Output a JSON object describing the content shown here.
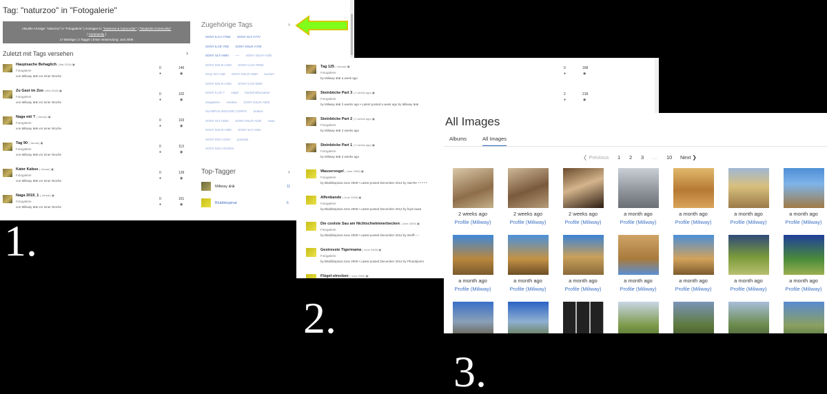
{
  "panel1": {
    "title": "Tag: \"naturzoo\" in \"Fotogalerie\"",
    "banner": {
      "line1": "Aktuelle Anzeige: \"naturzoo\" in \"Fotogalerie\" [ Anzeigen in:",
      "link1": "\"Kameras & Camcorder\"",
      "sep": "|",
      "link2": "\"Deutsche Community\"",
      "link3": "Community",
      "close": "]",
      "stats": "17 Beiträge   |   2 Tagger   |   Erste Verwendung:   Juni 2009"
    },
    "recent_heading": "Zuletzt mit Tags versehen",
    "chevron": "›",
    "rows": [
      {
        "name": "Hauptsache Behaglich",
        "date": "( Mai 2019)",
        "cat": "Fotogalerie",
        "by": "von Miliway ⊕⊕ vor einer Woche",
        "n1": "0",
        "n2": "146"
      },
      {
        "name": "Zu Gast im Zoo",
        "date": "( Mai 2018)",
        "cat": "Fotogalerie",
        "by": "von Miliway ⊕⊕ vor einer Woche",
        "n1": "0",
        "n2": "102"
      },
      {
        "name": "Naga mit ?",
        "date": "( Januar)",
        "cat": "Fotogalerie",
        "by": "von Miliway ⊕⊕ vor einer Woche",
        "n1": "0",
        "n2": "103"
      },
      {
        "name": "Tag 90",
        "date": "( Januar)",
        "cat": "Fotogalerie",
        "by": "von Miliway ⊕⊕ vor einer Woche",
        "n1": "0",
        "n2": "113"
      },
      {
        "name": "Kater Kabus",
        "date": "( Januar)",
        "cat": "Fotogalerie",
        "by": "von Miliway ⊕⊕ vor einer Woche",
        "n1": "0",
        "n2": "139"
      },
      {
        "name": "Naga 2019_1",
        "date": "( Januar)",
        "cat": "Fotogalerie",
        "by": "von Miliway ⊕⊕ vor einer Woche",
        "n1": "0",
        "n2": "161"
      }
    ],
    "tags_heading": "Zugehörige Tags",
    "tags": [
      "SONY ILCA-77M2",
      "SONY SLT-A77V",
      "SONY ILCE-7M2",
      "SONY DSLR-A700",
      "SONY SLT-A99V",
      "----",
      "SONY DSLR-A350",
      "SONY DSLR-A200",
      "SONY ILCE-7RM2",
      "Sony SLT-A58",
      "SONY DSLR-A850",
      "tourism",
      "SONY DSLR-A300",
      "SONY ILCE-6000",
      "SONY ILCE-7",
      "vögel",
      "landschaftszauber",
      "säugetiere",
      "masken",
      "SONY DSLR-A550",
      "OLYMPUS IMAGING CORP.E",
      "andere",
      "SONY SLT-A55V",
      "SONY DSLR-A230",
      "natur",
      "SONY DSLR-A390",
      "SONY SLT-A65V",
      "SONY DSC-HX5V",
      "portraits",
      "SONY DSC-HX400V"
    ],
    "toptagger_heading": "Top-Tagger",
    "taggers": [
      {
        "name": "Miliway ⊕⊕",
        "count": "11"
      },
      {
        "name": "Blubbbspinat",
        "count": "6"
      }
    ]
  },
  "panel2": {
    "rows": [
      {
        "name": "Tag 125",
        "date": "( Januar)",
        "cat": "Fotogalerie",
        "by": "by Miliway ⊕⊕ a week ago",
        "n1": "0",
        "n2": "168"
      },
      {
        "name": "Steinböcke Part 3",
        "date": "( 2 weeks ago)",
        "cat": "Fotogalerie",
        "by": "by Miliway ⊕⊕ 2 weeks ago  •  Latest posted a week ago by Miliway ⊕⊕",
        "n1": "2",
        "n2": "218"
      },
      {
        "name": "Steinböcke Part 2",
        "date": "( 2 weeks ago)",
        "cat": "Fotogalerie",
        "by": "by Miliway ⊕⊕ 2 weeks ago",
        "n1": "",
        "n2": ""
      },
      {
        "name": "Steinböcke Part 1",
        "date": "( 2 weeks ago)",
        "cat": "Fotogalerie",
        "by": "by Miliway ⊕⊕ 2 weeks ago",
        "n1": "",
        "n2": ""
      },
      {
        "name": "Wasservogel",
        "date": "( June 2009)",
        "cat": "Fotogalerie",
        "by": "by Blubbbspinat June 2009  •  Latest posted December 2012 by Sat-Re ∘∘∘∘∘",
        "n1": "",
        "n2": ""
      },
      {
        "name": "Affenbande",
        "date": "( June 2009)",
        "cat": "Fotogalerie",
        "by": "by Blubbbspinat June 2009  •  Latest posted December 2012 by feyd-rauta",
        "n1": "",
        "n2": ""
      },
      {
        "name": "Die coolste Sau am Nichtschwimmerbecken",
        "date": "( June 2009)",
        "cat": "Fotogalerie",
        "by": "by Blubbbspinat June 2009  •  Latest posted December 2012 by Wolff-----",
        "n1": "",
        "n2": ""
      },
      {
        "name": "Gestresste Tigermama",
        "date": "( June 2009)",
        "cat": "Fotogalerie",
        "by": "by Blubbbspinat June 2009  •  Latest posted December 2012 by Photobjoern",
        "n1": "",
        "n2": ""
      },
      {
        "name": "Flügel-strecken",
        "date": "( June 2009)",
        "cat": "",
        "by": "",
        "n1": "",
        "n2": ""
      }
    ]
  },
  "panel3": {
    "title": "All Images",
    "tabs": [
      "Albums",
      "All Images"
    ],
    "pager": {
      "prev": "❮  Previous",
      "pages": [
        "1",
        "2",
        "3",
        "...",
        "10"
      ],
      "next": "Next  ❯"
    },
    "tiles_row1": [
      {
        "ago": "2 weeks ago",
        "prof": "Profile (Miliway)"
      },
      {
        "ago": "2 weeks ago",
        "prof": "Profile (Miliway)"
      },
      {
        "ago": "2 weeks ago",
        "prof": "Profile (Miliway)"
      },
      {
        "ago": "a month ago",
        "prof": "Profile (Miliway)"
      },
      {
        "ago": "a month ago",
        "prof": "Profile (Miliway)"
      },
      {
        "ago": "a month ago",
        "prof": "Profile (Miliway)"
      },
      {
        "ago": "a month ago",
        "prof": "Profile (Miliway)"
      }
    ],
    "tiles_row2": [
      {
        "ago": "a month ago",
        "prof": "Profile (Miliway)"
      },
      {
        "ago": "a month ago",
        "prof": "Profile (Miliway)"
      },
      {
        "ago": "a month ago",
        "prof": "Profile (Miliway)"
      },
      {
        "ago": "a month ago",
        "prof": "Profile (Miliway)"
      },
      {
        "ago": "a month ago",
        "prof": "Profile (Miliway)"
      },
      {
        "ago": "a month ago",
        "prof": "Profile (Miliway)"
      },
      {
        "ago": "a month ago",
        "prof": "Profile (Miliway)"
      }
    ]
  },
  "labels": [
    "1.",
    "2.",
    "3."
  ],
  "colors": {
    "link": "#4a73c9",
    "arrow": "#7fff1a",
    "banner": "#7c7c7c",
    "background": "#000000"
  }
}
